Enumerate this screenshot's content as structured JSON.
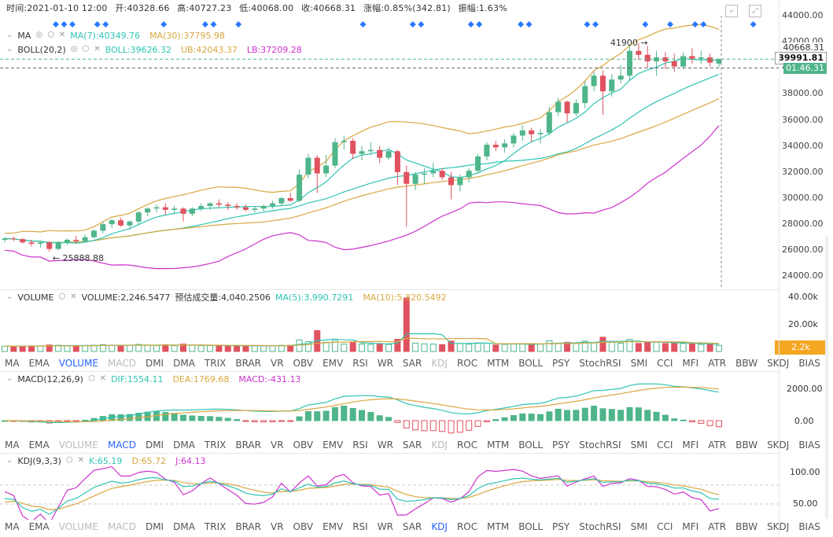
{
  "header": {
    "time_label": "时间:2021-01-10 12:00",
    "open_label": "开:40328.66",
    "high_label": "高:40727.23",
    "low_label": "低:40068.00",
    "close_label": "收:40668.31",
    "change_label": "涨幅:0.85%(342.81)",
    "amplitude_label": "振幅:1.63%"
  },
  "main_pane": {
    "ma": {
      "name": "MA",
      "ma7": "MA(7):40349.76",
      "ma30": "MA(30):37795.98"
    },
    "boll": {
      "name": "BOLL(20,2)",
      "boll": "BOLL:39626.32",
      "ub": "UB:42043.37",
      "lb": "LB:37209.28"
    },
    "y_ticks": [
      "24000.00",
      "26000.00",
      "28000.00",
      "30000.00",
      "32000.00",
      "34000.00",
      "36000.00",
      "38000.00",
      "40000.00",
      "42000.00",
      "44000.00"
    ],
    "last_price_tag": "40668.31",
    "crosshair_price_tag": "39991.81",
    "lower_tag": "01.46.31",
    "max_annotation": "41900",
    "min_annotation": "25888.88"
  },
  "volume_pane": {
    "name": "VOLUME",
    "volume": "VOLUME:2,246.5477",
    "estimated": "预估成交量:4,040.2506",
    "ma5": "MA(5):3,990.7291",
    "ma10": "MA(10):5,820.5492",
    "y_ticks": [
      "40.00k",
      "20.00k"
    ],
    "last_tag": "2.2k"
  },
  "macd_pane": {
    "name": "MACD(12,26,9)",
    "dif": "DIF:1554.11",
    "dea": "DEA:1769.68",
    "macd": "MACD:-431.13",
    "y_ticks": [
      "2000.00",
      "0.00"
    ]
  },
  "kdj_pane": {
    "name": "KDJ(9,3,3)",
    "k": "K:65.19",
    "d": "D:65.72",
    "j": "J:64.13",
    "y_ticks": [
      "100.00",
      "50.00"
    ]
  },
  "indicator_tabs": [
    "MA",
    "EMA",
    "VOLUME",
    "MACD",
    "DMI",
    "DMA",
    "TRIX",
    "BRAR",
    "VR",
    "OBV",
    "EMV",
    "RSI",
    "WR",
    "SAR",
    "KDJ",
    "ROC",
    "MTM",
    "BOLL",
    "PSY",
    "StochRSI",
    "SMI",
    "CCI",
    "MFI",
    "ATR",
    "BBW",
    "SKDJ",
    "BIAS"
  ],
  "tabbar1": {
    "active": "VOLUME",
    "disabled": [
      "MACD",
      "KDJ"
    ]
  },
  "tabbar2": {
    "active": "MACD",
    "disabled": [
      "VOLUME",
      "KDJ"
    ]
  },
  "tabbar3": {
    "active": "KDJ",
    "disabled": [
      "VOLUME",
      "MACD"
    ]
  },
  "colors": {
    "up": "#4fb58a",
    "down": "#e0525f",
    "ma7": "#2fc4b2",
    "ma30": "#d9a740",
    "boll_ub": "#d9a740",
    "boll_mid": "#2fc4b2",
    "boll_lb": "#cc33cc",
    "marker": "#2979ff",
    "price_tag_bg": "#4fb58a",
    "vol_tag_bg": "#f5a623"
  },
  "chart_data": {
    "type": "candlestick",
    "interval": "12h",
    "last_candle_time": "2021-01-10 12:00",
    "candles": [
      [
        26800,
        27000,
        26600,
        26900
      ],
      [
        26900,
        27050,
        26700,
        26850
      ],
      [
        26850,
        26950,
        26500,
        26600
      ],
      [
        26600,
        26800,
        26300,
        26500
      ],
      [
        26500,
        26700,
        26200,
        26600
      ],
      [
        26600,
        26700,
        25888.88,
        26100
      ],
      [
        26100,
        26700,
        26000,
        26600
      ],
      [
        26600,
        26900,
        26400,
        26800
      ],
      [
        26800,
        27100,
        26500,
        26700
      ],
      [
        26700,
        27200,
        26600,
        27000
      ],
      [
        27000,
        27600,
        26900,
        27500
      ],
      [
        27500,
        28200,
        27300,
        28000
      ],
      [
        28000,
        28400,
        27700,
        28300
      ],
      [
        28300,
        28500,
        27800,
        27900
      ],
      [
        27900,
        28300,
        27600,
        28200
      ],
      [
        28200,
        29000,
        28000,
        28900
      ],
      [
        28900,
        29300,
        28600,
        29200
      ],
      [
        29200,
        29500,
        28900,
        29300
      ],
      [
        29300,
        29600,
        28700,
        29100
      ],
      [
        29100,
        29400,
        28800,
        29200
      ],
      [
        29200,
        29300,
        28200,
        28800
      ],
      [
        28800,
        29300,
        28600,
        29200
      ],
      [
        29200,
        29600,
        29000,
        29400
      ],
      [
        29400,
        29700,
        29100,
        29600
      ],
      [
        29600,
        29900,
        29300,
        29500
      ],
      [
        29500,
        29700,
        29100,
        29400
      ],
      [
        29400,
        29600,
        29100,
        29300
      ],
      [
        29300,
        29500,
        29000,
        29100
      ],
      [
        29100,
        29400,
        28900,
        29200
      ],
      [
        29200,
        29500,
        29000,
        29400
      ],
      [
        29400,
        29800,
        29200,
        29600
      ],
      [
        29600,
        30100,
        29400,
        30000
      ],
      [
        30000,
        30400,
        29700,
        29800
      ],
      [
        29800,
        32200,
        29700,
        31800
      ],
      [
        31800,
        33400,
        31500,
        33100
      ],
      [
        33100,
        33300,
        30400,
        31900
      ],
      [
        31900,
        33300,
        31600,
        32500
      ],
      [
        32500,
        34600,
        32300,
        34300
      ],
      [
        34300,
        34800,
        33700,
        34400
      ],
      [
        34400,
        34600,
        33000,
        33400
      ],
      [
        33400,
        34000,
        32900,
        33600
      ],
      [
        33600,
        34300,
        33300,
        33700
      ],
      [
        33700,
        34000,
        32700,
        33100
      ],
      [
        33100,
        33900,
        32900,
        33600
      ],
      [
        33600,
        33700,
        31000,
        32000
      ],
      [
        32000,
        32500,
        27800,
        31100
      ],
      [
        31100,
        32000,
        30600,
        31800
      ],
      [
        31800,
        32300,
        31100,
        31900
      ],
      [
        31900,
        32700,
        31600,
        32100
      ],
      [
        32100,
        32300,
        31400,
        31600
      ],
      [
        31600,
        32000,
        29900,
        31000
      ],
      [
        31000,
        31800,
        30500,
        31600
      ],
      [
        31600,
        32300,
        31200,
        32100
      ],
      [
        32100,
        33400,
        31900,
        33200
      ],
      [
        33200,
        34300,
        32900,
        34100
      ],
      [
        34100,
        34400,
        33600,
        33900
      ],
      [
        33900,
        34500,
        33500,
        34200
      ],
      [
        34200,
        35000,
        33900,
        34800
      ],
      [
        34800,
        35600,
        34400,
        35200
      ],
      [
        35200,
        35400,
        34300,
        34900
      ],
      [
        34900,
        35300,
        34200,
        35000
      ],
      [
        35000,
        37000,
        34800,
        36600
      ],
      [
        36600,
        37700,
        36300,
        37400
      ],
      [
        37400,
        37500,
        35800,
        36500
      ],
      [
        36500,
        37600,
        36300,
        37300
      ],
      [
        37300,
        39000,
        36900,
        38600
      ],
      [
        38600,
        39700,
        38200,
        39400
      ],
      [
        39400,
        39800,
        36400,
        38200
      ],
      [
        38200,
        39500,
        37800,
        39100
      ],
      [
        39100,
        40200,
        38800,
        39400
      ],
      [
        39400,
        41700,
        39000,
        41300
      ],
      [
        41300,
        41900,
        40600,
        41000
      ],
      [
        41000,
        41700,
        40000,
        40500
      ],
      [
        40500,
        41300,
        39400,
        40800
      ],
      [
        40800,
        41200,
        39900,
        40500
      ],
      [
        40500,
        41100,
        39700,
        40100
      ],
      [
        40100,
        41200,
        39900,
        40900
      ],
      [
        40900,
        41500,
        40300,
        40700
      ],
      [
        40700,
        41300,
        40300,
        40800
      ],
      [
        40800,
        41100,
        40100,
        40400
      ],
      [
        40328.66,
        40727.23,
        40068.0,
        40668.31
      ]
    ],
    "ylim": [
      23000,
      44000
    ]
  }
}
